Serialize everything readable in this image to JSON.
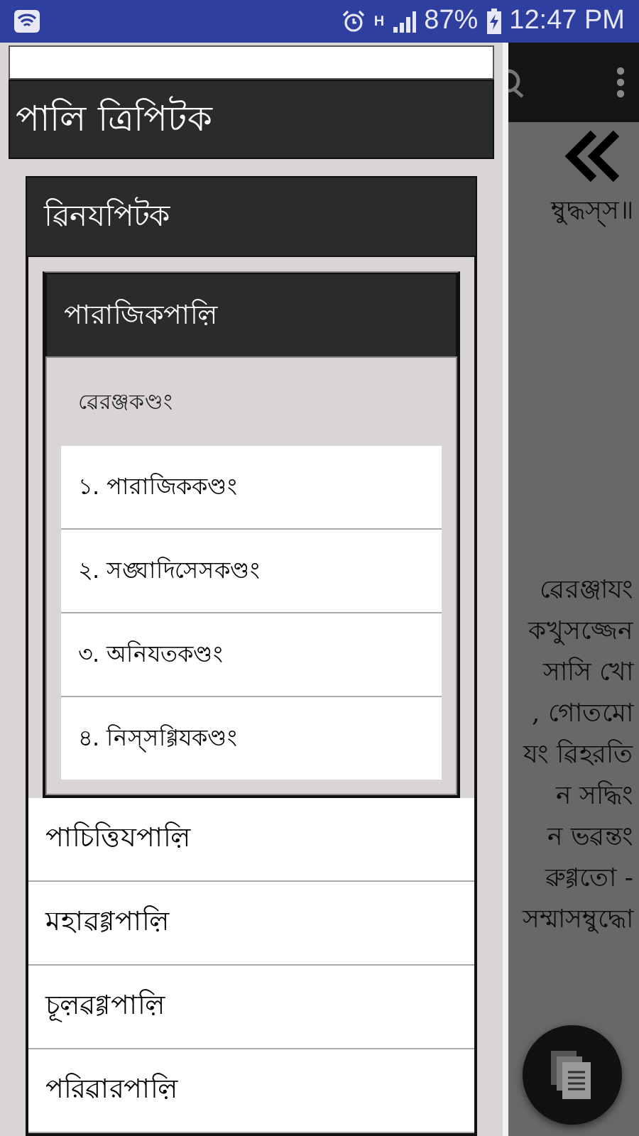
{
  "status_bar": {
    "network": "H",
    "battery": "87%",
    "time": "12:47 PM"
  },
  "drawer": {
    "title": "পালি ত্রিপিটক",
    "tree": [
      {
        "label": "ৱিনযপিটক",
        "expanded": true,
        "children": [
          {
            "label": "পারাজিকপাল়ি",
            "expanded": true,
            "children": [
              {
                "kind": "heading",
                "label": "ৱেরঞ্জকণ্ডং"
              },
              {
                "kind": "item",
                "label": "১. পারাজিককণ্ডং"
              },
              {
                "kind": "item",
                "label": "২. সঙ্ঘাদিসেসকণ্ডং"
              },
              {
                "kind": "item",
                "label": "৩. অনিযতকণ্ডং"
              },
              {
                "kind": "item",
                "label": "৪. নিস্সগ্গিযকণ্ডং"
              }
            ]
          },
          {
            "label": "পাচিত্তিযপাল়ি",
            "expanded": false
          },
          {
            "label": "মহাৱগ্গপাল়ি",
            "expanded": false
          },
          {
            "label": "চূল়ৱগ্গপাল়ি",
            "expanded": false
          },
          {
            "label": "পরিৱারপাল়ি",
            "expanded": false
          }
        ]
      }
    ]
  },
  "reader": {
    "intro": "ম্বুদ্ধস্স॥",
    "lines": [
      "ৱেরঞ্জাযং",
      "কখুসজ্জেন",
      "সাসি খো",
      ", গোতমো",
      "যং ৱিহরতি",
      "ন সদ্ধিং",
      "ন ভৱন্তং",
      "ৱুগ্গতো -",
      "সম্মাসম্বুদ্ধো"
    ]
  }
}
